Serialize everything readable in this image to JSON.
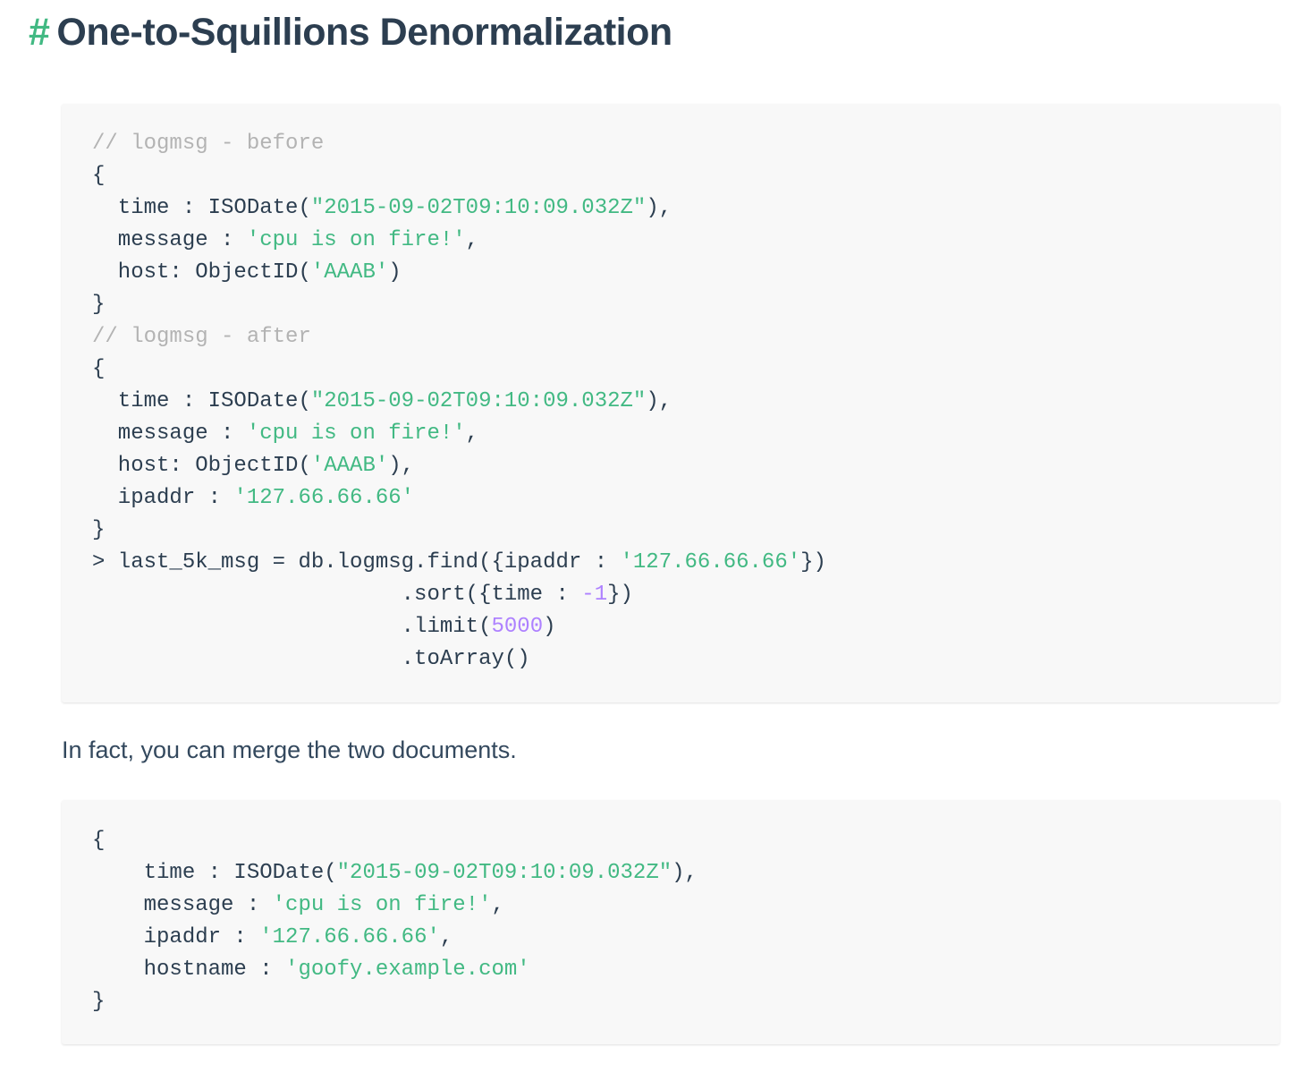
{
  "section": {
    "anchor_symbol": "#",
    "title": "One-to-Squillions Denormalization"
  },
  "code_blocks": [
    {
      "lines": [
        [
          {
            "t": "// logmsg - before",
            "k": "comment"
          }
        ],
        [
          {
            "t": "{",
            "k": "plain"
          }
        ],
        [
          {
            "t": "  time : ISODate(",
            "k": "plain"
          },
          {
            "t": "\"2015-09-02T09:10:09.032Z\"",
            "k": "string"
          },
          {
            "t": "),",
            "k": "plain"
          }
        ],
        [
          {
            "t": "  message : ",
            "k": "plain"
          },
          {
            "t": "'cpu is on fire!'",
            "k": "string"
          },
          {
            "t": ",",
            "k": "plain"
          }
        ],
        [
          {
            "t": "  host: ObjectID(",
            "k": "plain"
          },
          {
            "t": "'AAAB'",
            "k": "string"
          },
          {
            "t": ")",
            "k": "plain"
          }
        ],
        [
          {
            "t": "}",
            "k": "plain"
          }
        ],
        [
          {
            "t": "// logmsg - after",
            "k": "comment"
          }
        ],
        [
          {
            "t": "{",
            "k": "plain"
          }
        ],
        [
          {
            "t": "  time : ISODate(",
            "k": "plain"
          },
          {
            "t": "\"2015-09-02T09:10:09.032Z\"",
            "k": "string"
          },
          {
            "t": "),",
            "k": "plain"
          }
        ],
        [
          {
            "t": "  message : ",
            "k": "plain"
          },
          {
            "t": "'cpu is on fire!'",
            "k": "string"
          },
          {
            "t": ",",
            "k": "plain"
          }
        ],
        [
          {
            "t": "  host: ObjectID(",
            "k": "plain"
          },
          {
            "t": "'AAAB'",
            "k": "string"
          },
          {
            "t": "),",
            "k": "plain"
          }
        ],
        [
          {
            "t": "  ipaddr : ",
            "k": "plain"
          },
          {
            "t": "'127.66.66.66'",
            "k": "string"
          }
        ],
        [
          {
            "t": "}",
            "k": "plain"
          }
        ],
        [
          {
            "t": "> last_5k_msg = db.logmsg.find({ipaddr : ",
            "k": "plain"
          },
          {
            "t": "'127.66.66.66'",
            "k": "string"
          },
          {
            "t": "})",
            "k": "plain"
          }
        ],
        [
          {
            "t": "                        .sort({time : ",
            "k": "plain"
          },
          {
            "t": "-1",
            "k": "number"
          },
          {
            "t": "})",
            "k": "plain"
          }
        ],
        [
          {
            "t": "                        .limit(",
            "k": "plain"
          },
          {
            "t": "5000",
            "k": "number"
          },
          {
            "t": ")",
            "k": "plain"
          }
        ],
        [
          {
            "t": "                        .toArray()",
            "k": "plain"
          }
        ]
      ]
    },
    {
      "lines": [
        [
          {
            "t": "{",
            "k": "plain"
          }
        ],
        [
          {
            "t": "    time : ISODate(",
            "k": "plain"
          },
          {
            "t": "\"2015-09-02T09:10:09.032Z\"",
            "k": "string"
          },
          {
            "t": "),",
            "k": "plain"
          }
        ],
        [
          {
            "t": "    message : ",
            "k": "plain"
          },
          {
            "t": "'cpu is on fire!'",
            "k": "string"
          },
          {
            "t": ",",
            "k": "plain"
          }
        ],
        [
          {
            "t": "    ipaddr : ",
            "k": "plain"
          },
          {
            "t": "'127.66.66.66'",
            "k": "string"
          },
          {
            "t": ",",
            "k": "plain"
          }
        ],
        [
          {
            "t": "    hostname : ",
            "k": "plain"
          },
          {
            "t": "'goofy.example.com'",
            "k": "string"
          }
        ],
        [
          {
            "t": "}",
            "k": "plain"
          }
        ]
      ]
    }
  ],
  "paragraph": "In fact, you can merge the two documents.",
  "colors": {
    "accent": "#42b983",
    "heading": "#2c3e50",
    "comment": "#b3b3b3",
    "number": "#ae81ff",
    "code_background": "#f8f8f8"
  }
}
